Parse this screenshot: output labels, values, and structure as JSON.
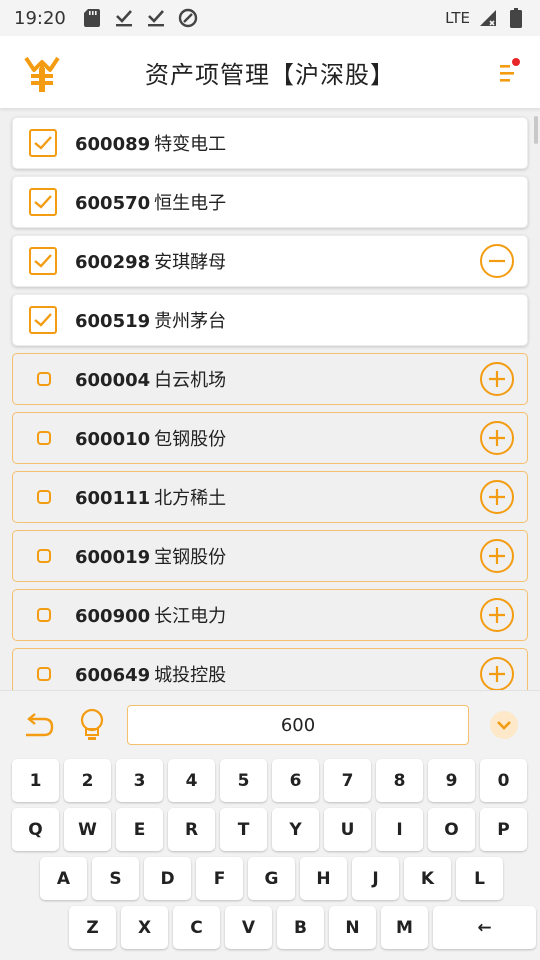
{
  "status_bar": {
    "time": "19:20",
    "network": "LTE"
  },
  "app_bar": {
    "title": "资产项管理【沪深股】"
  },
  "colors": {
    "accent": "#f39c12",
    "notification_dot": "#e8262a"
  },
  "stocks": [
    {
      "code": "600089",
      "name": "特变电工",
      "checked": true,
      "action": "none"
    },
    {
      "code": "600570",
      "name": "恒生电子",
      "checked": true,
      "action": "none"
    },
    {
      "code": "600298",
      "name": "安琪酵母",
      "checked": true,
      "action": "remove"
    },
    {
      "code": "600519",
      "name": "贵州茅台",
      "checked": true,
      "action": "none"
    },
    {
      "code": "600004",
      "name": "白云机场",
      "checked": false,
      "action": "add"
    },
    {
      "code": "600010",
      "name": "包钢股份",
      "checked": false,
      "action": "add"
    },
    {
      "code": "600111",
      "name": "北方稀土",
      "checked": false,
      "action": "add"
    },
    {
      "code": "600019",
      "name": "宝钢股份",
      "checked": false,
      "action": "add"
    },
    {
      "code": "600900",
      "name": "长江电力",
      "checked": false,
      "action": "add"
    },
    {
      "code": "600649",
      "name": "城投控股",
      "checked": false,
      "action": "add"
    }
  ],
  "keyboard": {
    "input_value": "600",
    "row1": [
      "1",
      "2",
      "3",
      "4",
      "5",
      "6",
      "7",
      "8",
      "9",
      "0"
    ],
    "row2": [
      "Q",
      "W",
      "E",
      "R",
      "T",
      "Y",
      "U",
      "I",
      "O",
      "P"
    ],
    "row3": [
      "A",
      "S",
      "D",
      "F",
      "G",
      "H",
      "J",
      "K",
      "L"
    ],
    "row4": [
      "Z",
      "X",
      "C",
      "V",
      "B",
      "N",
      "M",
      "←"
    ]
  }
}
